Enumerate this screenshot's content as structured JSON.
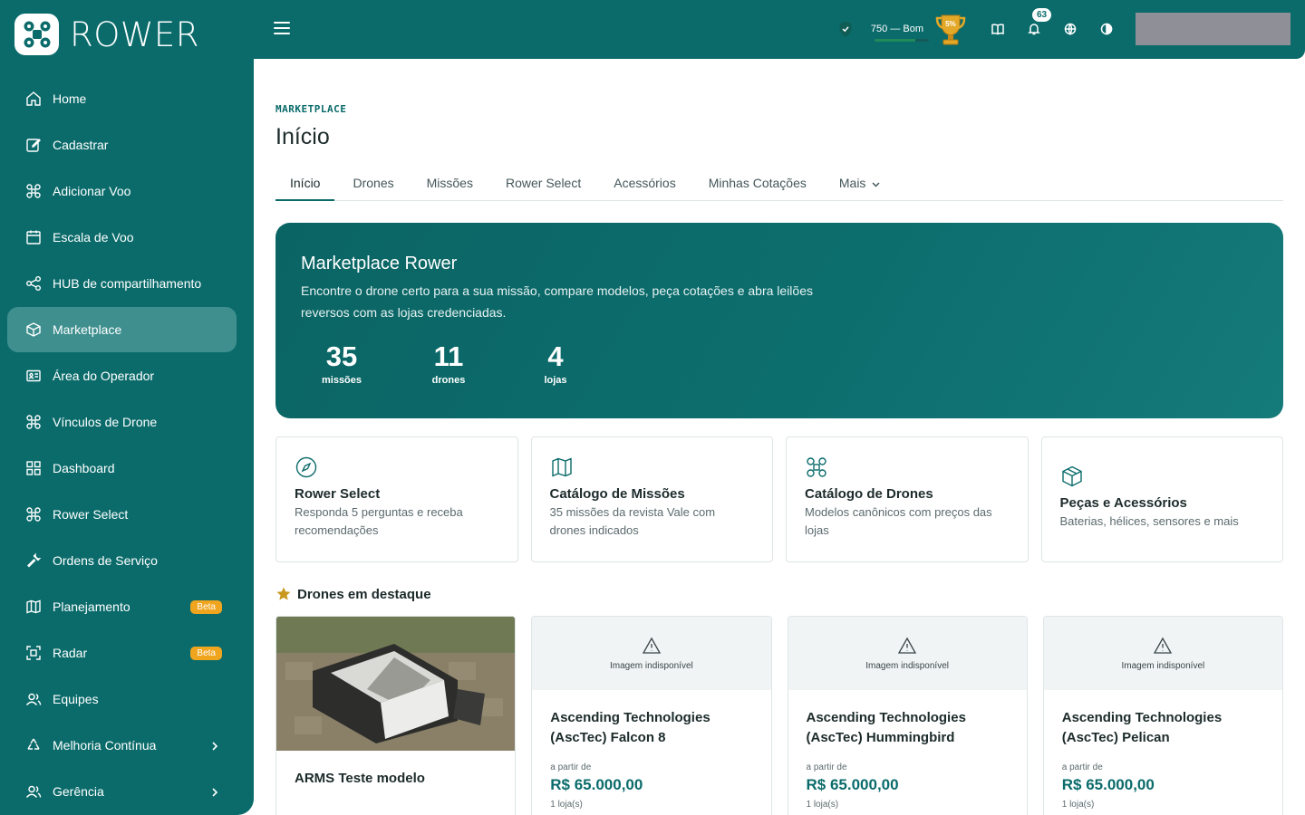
{
  "brand": {
    "name": "ROWER"
  },
  "sidebar": {
    "items": [
      {
        "label": "Home",
        "icon": "home-icon"
      },
      {
        "label": "Cadastrar",
        "icon": "edit-icon"
      },
      {
        "label": "Adicionar Voo",
        "icon": "drone-icon"
      },
      {
        "label": "Escala de Voo",
        "icon": "calendar-icon"
      },
      {
        "label": "HUB de compartilhamento",
        "icon": "share-icon"
      },
      {
        "label": "Marketplace",
        "icon": "box-icon",
        "active": true
      },
      {
        "label": "Área do Operador",
        "icon": "id-card-icon"
      },
      {
        "label": "Vínculos de Drone",
        "icon": "drone-icon"
      },
      {
        "label": "Dashboard",
        "icon": "grid-icon"
      },
      {
        "label": "Rower Select",
        "icon": "drone-icon"
      },
      {
        "label": "Ordens de Serviço",
        "icon": "wrench-icon"
      },
      {
        "label": "Planejamento",
        "icon": "map-icon",
        "badge": "Beta"
      },
      {
        "label": "Radar",
        "icon": "radar-icon",
        "badge": "Beta"
      },
      {
        "label": "Equipes",
        "icon": "users-icon"
      },
      {
        "label": "Melhoria Contínua",
        "icon": "recycle-icon",
        "chevron": true
      },
      {
        "label": "Gerência",
        "icon": "users-icon",
        "chevron": true
      }
    ]
  },
  "topbar": {
    "score_text": "750 — Bom",
    "score_progress": 0.75,
    "trophy_label": "5%",
    "notifications_count": "63",
    "colors": {
      "accent": "#0b6b6b",
      "beta": "#f0a51f"
    }
  },
  "main": {
    "eyebrow": "MARKETPLACE",
    "title": "Início",
    "tabs": [
      "Início",
      "Drones",
      "Missões",
      "Rower Select",
      "Acessórios",
      "Minhas Cotações",
      "Mais"
    ],
    "hero": {
      "title": "Marketplace Rower",
      "description": "Encontre o drone certo para a sua missão, compare modelos, peça cotações e abra leilões reversos com as lojas credenciadas.",
      "stats": [
        {
          "value": "35",
          "label": "missões"
        },
        {
          "value": "11",
          "label": "drones"
        },
        {
          "value": "4",
          "label": "lojas"
        }
      ]
    },
    "cards": [
      {
        "title": "Rower Select",
        "desc": "Responda 5 perguntas e receba recomendações",
        "icon": "compass-icon"
      },
      {
        "title": "Catálogo de Missões",
        "desc": "35 missões da revista Vale com drones indicados",
        "icon": "map-icon"
      },
      {
        "title": "Catálogo de Drones",
        "desc": "Modelos canônicos com preços das lojas",
        "icon": "drone-icon"
      },
      {
        "title": "Peças e Acessórios",
        "desc": "Baterias, hélices, sensores e mais",
        "icon": "box-icon"
      }
    ],
    "featured_title": "Drones em destaque",
    "products": [
      {
        "name": "ARMS Teste modelo",
        "has_image": true
      },
      {
        "name": "Ascending Technologies (AscTec) Falcon 8",
        "noimg": "Imagem indisponível",
        "from": "a partir de",
        "price": "R$ 65.000,00",
        "stores": "1 loja(s)"
      },
      {
        "name": "Ascending Technologies (AscTec) Hummingbird",
        "noimg": "Imagem indisponível",
        "from": "a partir de",
        "price": "R$ 65.000,00",
        "stores": "1 loja(s)"
      },
      {
        "name": "Ascending Technologies (AscTec) Pelican",
        "noimg": "Imagem indisponível",
        "from": "a partir de",
        "price": "R$ 65.000,00",
        "stores": "1 loja(s)"
      }
    ]
  }
}
